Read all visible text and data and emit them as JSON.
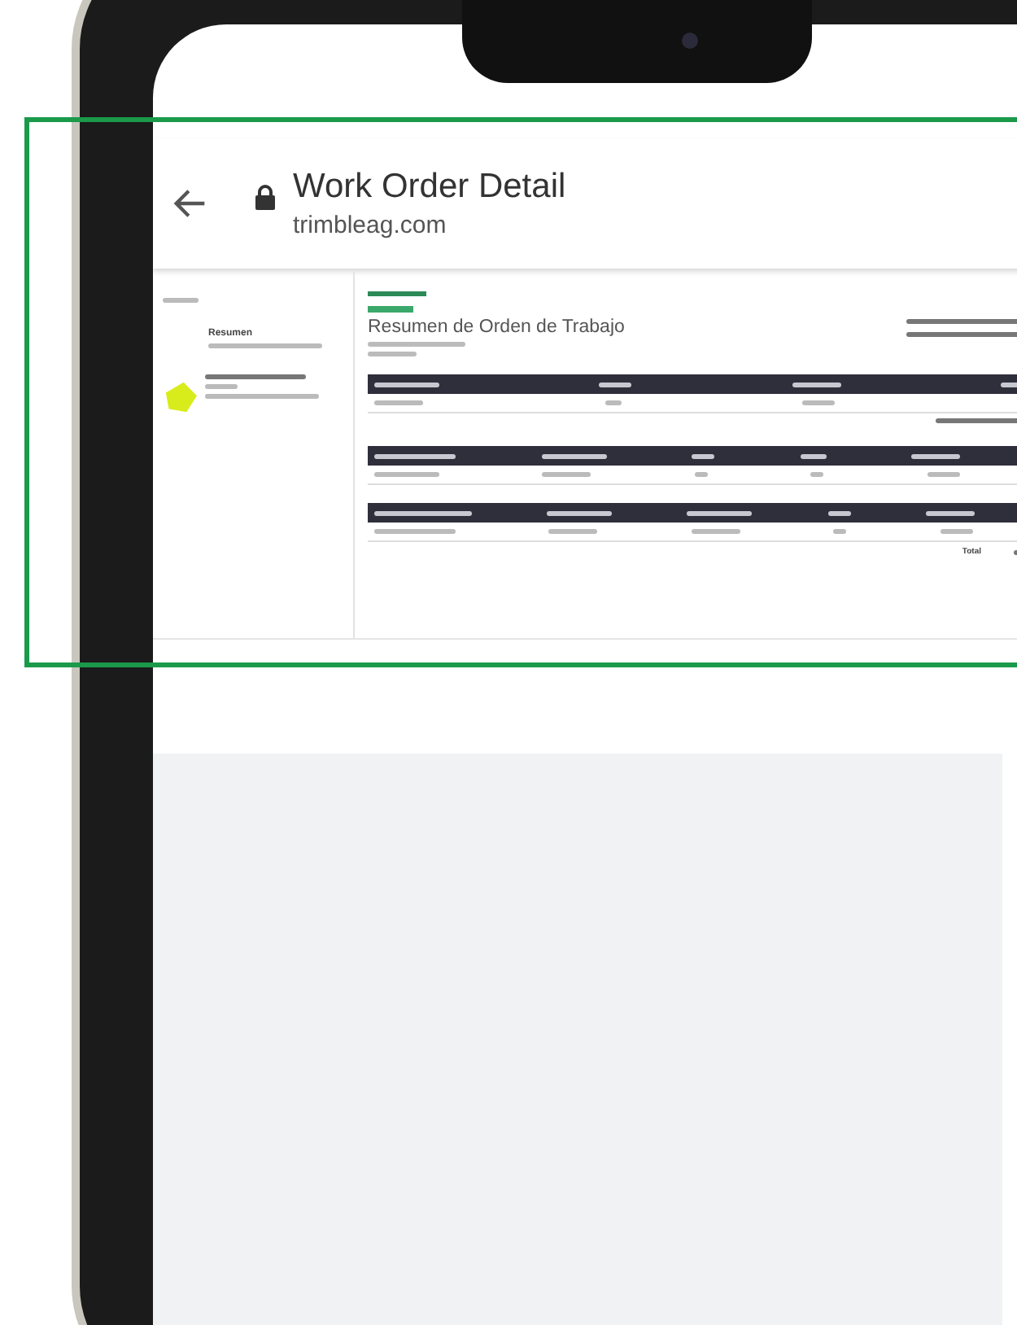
{
  "browser_bar": {
    "title": "Work Order Detail",
    "url": "trimbleag.com"
  },
  "report": {
    "sidebar": {
      "items": [
        {
          "kind": "summary",
          "title": "Resumen"
        },
        {
          "kind": "field"
        }
      ]
    },
    "title": "Resumen de Orden de Trabajo",
    "tables": [
      {
        "kind": "activity"
      },
      {
        "kind": "chemicals"
      },
      {
        "kind": "products",
        "total_label": "Total"
      }
    ]
  }
}
